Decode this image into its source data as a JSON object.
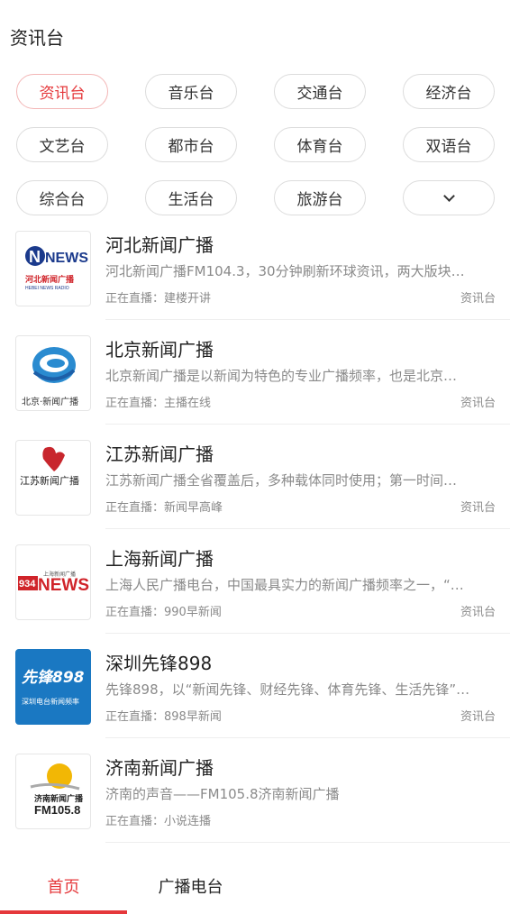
{
  "header": {
    "title": "资讯台"
  },
  "categories": [
    "资讯台",
    "音乐台",
    "交通台",
    "经济台",
    "文艺台",
    "都市台",
    "体育台",
    "双语台",
    "综合台",
    "生活台",
    "旅游台"
  ],
  "stations": [
    {
      "name": "河北新闻广播",
      "desc": "河北新闻广播FM104.3，30分钟刷新环球资讯，两大版块…",
      "live": "正在直播：建楼开讲",
      "tag": "资讯台",
      "logo": {
        "line1": "NEWS",
        "line2": "河北新闻广播",
        "line3": "HEBEI NEWS RADIO"
      }
    },
    {
      "name": "北京新闻广播",
      "desc": "北京新闻广播是以新闻为特色的专业广播频率，也是北京…",
      "live": "正在直播：主播在线",
      "tag": "资讯台",
      "logo": {
        "line1": "北京·新闻广播"
      }
    },
    {
      "name": "江苏新闻广播",
      "desc": "江苏新闻广播全省覆盖后，多种载体同时使用；第一时间…",
      "live": "正在直播：新闻早高峰",
      "tag": "资讯台",
      "logo": {
        "line1": "江苏新闻广播"
      }
    },
    {
      "name": "上海新闻广播",
      "desc": "上海人民广播电台，中国最具实力的新闻广播频率之一，“…",
      "live": "正在直播：990早新闻",
      "tag": "资讯台",
      "logo": {
        "line1": "934",
        "line2": "NEWS",
        "line3": "上海新闻广播"
      }
    },
    {
      "name": "深圳先锋898",
      "desc": "先锋898，以“新闻先锋、财经先锋、体育先锋、生活先锋”…",
      "live": "正在直播：898早新闻",
      "tag": "资讯台",
      "logo": {
        "line1": "先锋898",
        "line2": "深圳电台新闻频率"
      }
    },
    {
      "name": "济南新闻广播",
      "desc": "济南的声音——FM105.8济南新闻广播",
      "live": "正在直播：小说连播",
      "tag": "",
      "logo": {
        "line1": "济南新闻广播",
        "line2": "FM105.8"
      }
    }
  ],
  "tabbar": {
    "home": "首页",
    "radio": "广播电台"
  },
  "colors": {
    "accent": "#e5383b"
  }
}
